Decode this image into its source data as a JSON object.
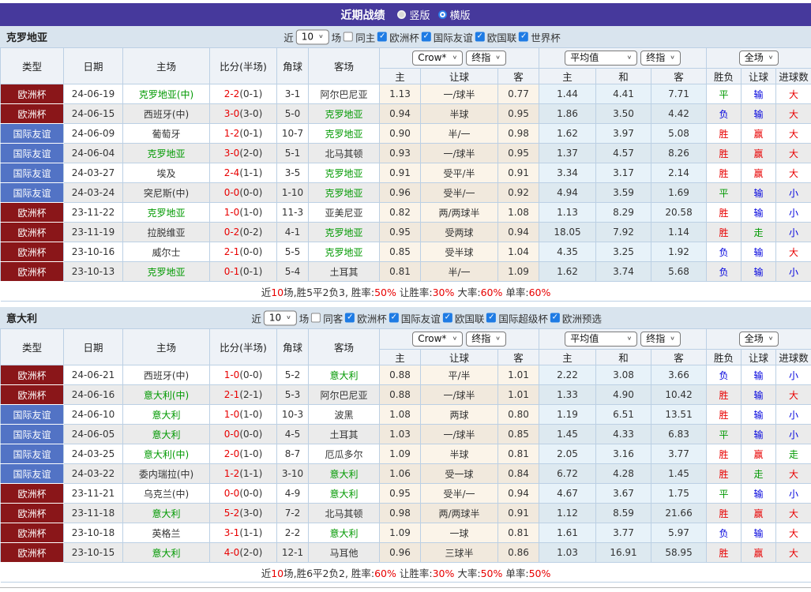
{
  "top": {
    "title": "近期战绩",
    "options": [
      {
        "label": "竖版",
        "selected": false
      },
      {
        "label": "横版",
        "selected": true
      }
    ]
  },
  "labels": {
    "near": "近",
    "games": "场"
  },
  "colors": {
    "topbar_bg": "#46399c",
    "type_red_bg": "#8a1619",
    "type_blue_bg": "#5273c5",
    "green": "#009900",
    "red": "#e80000",
    "blue": "#0000dd",
    "checkbox_blue": "#1e7be4",
    "section_bg": "#d9e4ee",
    "header_bg": "#eef2f7",
    "border": "#bcd0e4",
    "row_even": "#ebebeb",
    "crow_col": "#fbf4e9",
    "avg_col": "#e7f2f9"
  },
  "table_header": {
    "cols": [
      "类型",
      "日期",
      "主场",
      "比分(半场)",
      "角球",
      "客场"
    ],
    "crow_selects": [
      "Crow*",
      "终指"
    ],
    "avg_selects": [
      "平均值",
      "终指"
    ],
    "period_select": "全场",
    "subs": [
      "主",
      "让球",
      "客",
      "主",
      "和",
      "客",
      "胜负",
      "让球",
      "进球数"
    ]
  },
  "sections": [
    {
      "team": "克罗地亚",
      "filter": {
        "count": "10",
        "same_label": "同主",
        "same_checked": false,
        "leagues": [
          "欧洲杯",
          "国际友谊",
          "欧国联",
          "世界杯"
        ]
      },
      "rows": [
        {
          "type": "欧洲杯",
          "tc": "r",
          "date": "24-06-19",
          "home": "克罗地亚(中)",
          "hg": true,
          "score": "2-2",
          "half": "(0-1)",
          "corner": "3-1",
          "away": "阿尔巴尼亚",
          "ag": false,
          "crow": [
            "1.13",
            "一/球半",
            "0.77"
          ],
          "avg": [
            "1.44",
            "4.41",
            "7.71"
          ],
          "res": [
            [
              "平",
              "g"
            ],
            [
              "输",
              "b"
            ],
            [
              "大",
              "r"
            ]
          ]
        },
        {
          "type": "欧洲杯",
          "tc": "r",
          "date": "24-06-15",
          "home": "西班牙(中)",
          "hg": false,
          "score": "3-0",
          "half": "(3-0)",
          "corner": "5-0",
          "away": "克罗地亚",
          "ag": true,
          "crow": [
            "0.94",
            "半球",
            "0.95"
          ],
          "avg": [
            "1.86",
            "3.50",
            "4.42"
          ],
          "res": [
            [
              "负",
              "b"
            ],
            [
              "输",
              "b"
            ],
            [
              "大",
              "r"
            ]
          ]
        },
        {
          "type": "国际友谊",
          "tc": "b",
          "date": "24-06-09",
          "home": "葡萄牙",
          "hg": false,
          "score": "1-2",
          "half": "(0-1)",
          "corner": "10-7",
          "away": "克罗地亚",
          "ag": true,
          "crow": [
            "0.90",
            "半/一",
            "0.98"
          ],
          "avg": [
            "1.62",
            "3.97",
            "5.08"
          ],
          "res": [
            [
              "胜",
              "r"
            ],
            [
              "赢",
              "r"
            ],
            [
              "大",
              "r"
            ]
          ]
        },
        {
          "type": "国际友谊",
          "tc": "b",
          "date": "24-06-04",
          "home": "克罗地亚",
          "hg": true,
          "score": "3-0",
          "half": "(2-0)",
          "corner": "5-1",
          "away": "北马其顿",
          "ag": false,
          "crow": [
            "0.93",
            "一/球半",
            "0.95"
          ],
          "avg": [
            "1.37",
            "4.57",
            "8.26"
          ],
          "res": [
            [
              "胜",
              "r"
            ],
            [
              "赢",
              "r"
            ],
            [
              "大",
              "r"
            ]
          ]
        },
        {
          "type": "国际友谊",
          "tc": "b",
          "date": "24-03-27",
          "home": "埃及",
          "hg": false,
          "score": "2-4",
          "half": "(1-1)",
          "corner": "3-5",
          "away": "克罗地亚",
          "ag": true,
          "crow": [
            "0.91",
            "受平/半",
            "0.91"
          ],
          "avg": [
            "3.34",
            "3.17",
            "2.14"
          ],
          "res": [
            [
              "胜",
              "r"
            ],
            [
              "赢",
              "r"
            ],
            [
              "大",
              "r"
            ]
          ]
        },
        {
          "type": "国际友谊",
          "tc": "b",
          "date": "24-03-24",
          "home": "突尼斯(中)",
          "hg": false,
          "score": "0-0",
          "half": "(0-0)",
          "corner": "1-10",
          "away": "克罗地亚",
          "ag": true,
          "crow": [
            "0.96",
            "受半/一",
            "0.92"
          ],
          "avg": [
            "4.94",
            "3.59",
            "1.69"
          ],
          "res": [
            [
              "平",
              "g"
            ],
            [
              "输",
              "b"
            ],
            [
              "小",
              "b"
            ]
          ]
        },
        {
          "type": "欧洲杯",
          "tc": "r",
          "date": "23-11-22",
          "home": "克罗地亚",
          "hg": true,
          "score": "1-0",
          "half": "(1-0)",
          "corner": "11-3",
          "away": "亚美尼亚",
          "ag": false,
          "crow": [
            "0.82",
            "两/两球半",
            "1.08"
          ],
          "avg": [
            "1.13",
            "8.29",
            "20.58"
          ],
          "res": [
            [
              "胜",
              "r"
            ],
            [
              "输",
              "b"
            ],
            [
              "小",
              "b"
            ]
          ]
        },
        {
          "type": "欧洲杯",
          "tc": "r",
          "date": "23-11-19",
          "home": "拉脱维亚",
          "hg": false,
          "score": "0-2",
          "half": "(0-2)",
          "corner": "4-1",
          "away": "克罗地亚",
          "ag": true,
          "crow": [
            "0.95",
            "受两球",
            "0.94"
          ],
          "avg": [
            "18.05",
            "7.92",
            "1.14"
          ],
          "res": [
            [
              "胜",
              "r"
            ],
            [
              "走",
              "g"
            ],
            [
              "小",
              "b"
            ]
          ]
        },
        {
          "type": "欧洲杯",
          "tc": "r",
          "date": "23-10-16",
          "home": "威尔士",
          "hg": false,
          "score": "2-1",
          "half": "(0-0)",
          "corner": "5-5",
          "away": "克罗地亚",
          "ag": true,
          "crow": [
            "0.85",
            "受半球",
            "1.04"
          ],
          "avg": [
            "4.35",
            "3.25",
            "1.92"
          ],
          "res": [
            [
              "负",
              "b"
            ],
            [
              "输",
              "b"
            ],
            [
              "大",
              "r"
            ]
          ]
        },
        {
          "type": "欧洲杯",
          "tc": "r",
          "date": "23-10-13",
          "home": "克罗地亚",
          "hg": true,
          "score": "0-1",
          "half": "(0-1)",
          "corner": "5-4",
          "away": "土耳其",
          "ag": false,
          "crow": [
            "0.81",
            "半/一",
            "1.09"
          ],
          "avg": [
            "1.62",
            "3.74",
            "5.68"
          ],
          "res": [
            [
              "负",
              "b"
            ],
            [
              "输",
              "b"
            ],
            [
              "小",
              "b"
            ]
          ]
        }
      ],
      "summary": [
        {
          "t": "近"
        },
        {
          "t": "10",
          "red": true
        },
        {
          "t": "场,胜5平2负3, 胜率:"
        },
        {
          "t": "50%",
          "red": true
        },
        {
          "t": " 让胜率:"
        },
        {
          "t": "30%",
          "red": true
        },
        {
          "t": " 大率:"
        },
        {
          "t": "60%",
          "red": true
        },
        {
          "t": " 单率:"
        },
        {
          "t": "60%",
          "red": true
        }
      ]
    },
    {
      "team": "意大利",
      "filter": {
        "count": "10",
        "same_label": "同客",
        "same_checked": false,
        "leagues": [
          "欧洲杯",
          "国际友谊",
          "欧国联",
          "国际超级杯",
          "欧洲预选"
        ]
      },
      "rows": [
        {
          "type": "欧洲杯",
          "tc": "r",
          "date": "24-06-21",
          "home": "西班牙(中)",
          "hg": false,
          "score": "1-0",
          "half": "(0-0)",
          "corner": "5-2",
          "away": "意大利",
          "ag": true,
          "crow": [
            "0.88",
            "平/半",
            "1.01"
          ],
          "avg": [
            "2.22",
            "3.08",
            "3.66"
          ],
          "res": [
            [
              "负",
              "b"
            ],
            [
              "输",
              "b"
            ],
            [
              "小",
              "b"
            ]
          ]
        },
        {
          "type": "欧洲杯",
          "tc": "r",
          "date": "24-06-16",
          "home": "意大利(中)",
          "hg": true,
          "score": "2-1",
          "half": "(2-1)",
          "corner": "5-3",
          "away": "阿尔巴尼亚",
          "ag": false,
          "crow": [
            "0.88",
            "一/球半",
            "1.01"
          ],
          "avg": [
            "1.33",
            "4.90",
            "10.42"
          ],
          "res": [
            [
              "胜",
              "r"
            ],
            [
              "输",
              "b"
            ],
            [
              "大",
              "r"
            ]
          ]
        },
        {
          "type": "国际友谊",
          "tc": "b",
          "date": "24-06-10",
          "home": "意大利",
          "hg": true,
          "score": "1-0",
          "half": "(1-0)",
          "corner": "10-3",
          "away": "波黑",
          "ag": false,
          "crow": [
            "1.08",
            "两球",
            "0.80"
          ],
          "avg": [
            "1.19",
            "6.51",
            "13.51"
          ],
          "res": [
            [
              "胜",
              "r"
            ],
            [
              "输",
              "b"
            ],
            [
              "小",
              "b"
            ]
          ]
        },
        {
          "type": "国际友谊",
          "tc": "b",
          "date": "24-06-05",
          "home": "意大利",
          "hg": true,
          "score": "0-0",
          "half": "(0-0)",
          "corner": "4-5",
          "away": "土耳其",
          "ag": false,
          "crow": [
            "1.03",
            "一/球半",
            "0.85"
          ],
          "avg": [
            "1.45",
            "4.33",
            "6.83"
          ],
          "res": [
            [
              "平",
              "g"
            ],
            [
              "输",
              "b"
            ],
            [
              "小",
              "b"
            ]
          ]
        },
        {
          "type": "国际友谊",
          "tc": "b",
          "date": "24-03-25",
          "home": "意大利(中)",
          "hg": true,
          "score": "2-0",
          "half": "(1-0)",
          "corner": "8-7",
          "away": "厄瓜多尔",
          "ag": false,
          "crow": [
            "1.09",
            "半球",
            "0.81"
          ],
          "avg": [
            "2.05",
            "3.16",
            "3.77"
          ],
          "res": [
            [
              "胜",
              "r"
            ],
            [
              "赢",
              "r"
            ],
            [
              "走",
              "g"
            ]
          ]
        },
        {
          "type": "国际友谊",
          "tc": "b",
          "date": "24-03-22",
          "home": "委内瑞拉(中)",
          "hg": false,
          "score": "1-2",
          "half": "(1-1)",
          "corner": "3-10",
          "away": "意大利",
          "ag": true,
          "crow": [
            "1.06",
            "受一球",
            "0.84"
          ],
          "avg": [
            "6.72",
            "4.28",
            "1.45"
          ],
          "res": [
            [
              "胜",
              "r"
            ],
            [
              "走",
              "g"
            ],
            [
              "大",
              "r"
            ]
          ]
        },
        {
          "type": "欧洲杯",
          "tc": "r",
          "date": "23-11-21",
          "home": "乌克兰(中)",
          "hg": false,
          "score": "0-0",
          "half": "(0-0)",
          "corner": "4-9",
          "away": "意大利",
          "ag": true,
          "crow": [
            "0.95",
            "受半/一",
            "0.94"
          ],
          "avg": [
            "4.67",
            "3.67",
            "1.75"
          ],
          "res": [
            [
              "平",
              "g"
            ],
            [
              "输",
              "b"
            ],
            [
              "小",
              "b"
            ]
          ]
        },
        {
          "type": "欧洲杯",
          "tc": "r",
          "date": "23-11-18",
          "home": "意大利",
          "hg": true,
          "score": "5-2",
          "half": "(3-0)",
          "corner": "7-2",
          "away": "北马其顿",
          "ag": false,
          "crow": [
            "0.98",
            "两/两球半",
            "0.91"
          ],
          "avg": [
            "1.12",
            "8.59",
            "21.66"
          ],
          "res": [
            [
              "胜",
              "r"
            ],
            [
              "赢",
              "r"
            ],
            [
              "大",
              "r"
            ]
          ]
        },
        {
          "type": "欧洲杯",
          "tc": "r",
          "date": "23-10-18",
          "home": "英格兰",
          "hg": false,
          "score": "3-1",
          "half": "(1-1)",
          "corner": "2-2",
          "away": "意大利",
          "ag": true,
          "crow": [
            "1.09",
            "一球",
            "0.81"
          ],
          "avg": [
            "1.61",
            "3.77",
            "5.97"
          ],
          "res": [
            [
              "负",
              "b"
            ],
            [
              "输",
              "b"
            ],
            [
              "大",
              "r"
            ]
          ]
        },
        {
          "type": "欧洲杯",
          "tc": "r",
          "date": "23-10-15",
          "home": "意大利",
          "hg": true,
          "score": "4-0",
          "half": "(2-0)",
          "corner": "12-1",
          "away": "马耳他",
          "ag": false,
          "crow": [
            "0.96",
            "三球半",
            "0.86"
          ],
          "avg": [
            "1.03",
            "16.91",
            "58.95"
          ],
          "res": [
            [
              "胜",
              "r"
            ],
            [
              "赢",
              "r"
            ],
            [
              "大",
              "r"
            ]
          ]
        }
      ],
      "summary": [
        {
          "t": "近"
        },
        {
          "t": "10",
          "red": true
        },
        {
          "t": "场,胜6平2负2, 胜率:"
        },
        {
          "t": "60%",
          "red": true
        },
        {
          "t": " 让胜率:"
        },
        {
          "t": "30%",
          "red": true
        },
        {
          "t": " 大率:"
        },
        {
          "t": "50%",
          "red": true
        },
        {
          "t": " 单率:"
        },
        {
          "t": "50%",
          "red": true
        }
      ]
    }
  ]
}
